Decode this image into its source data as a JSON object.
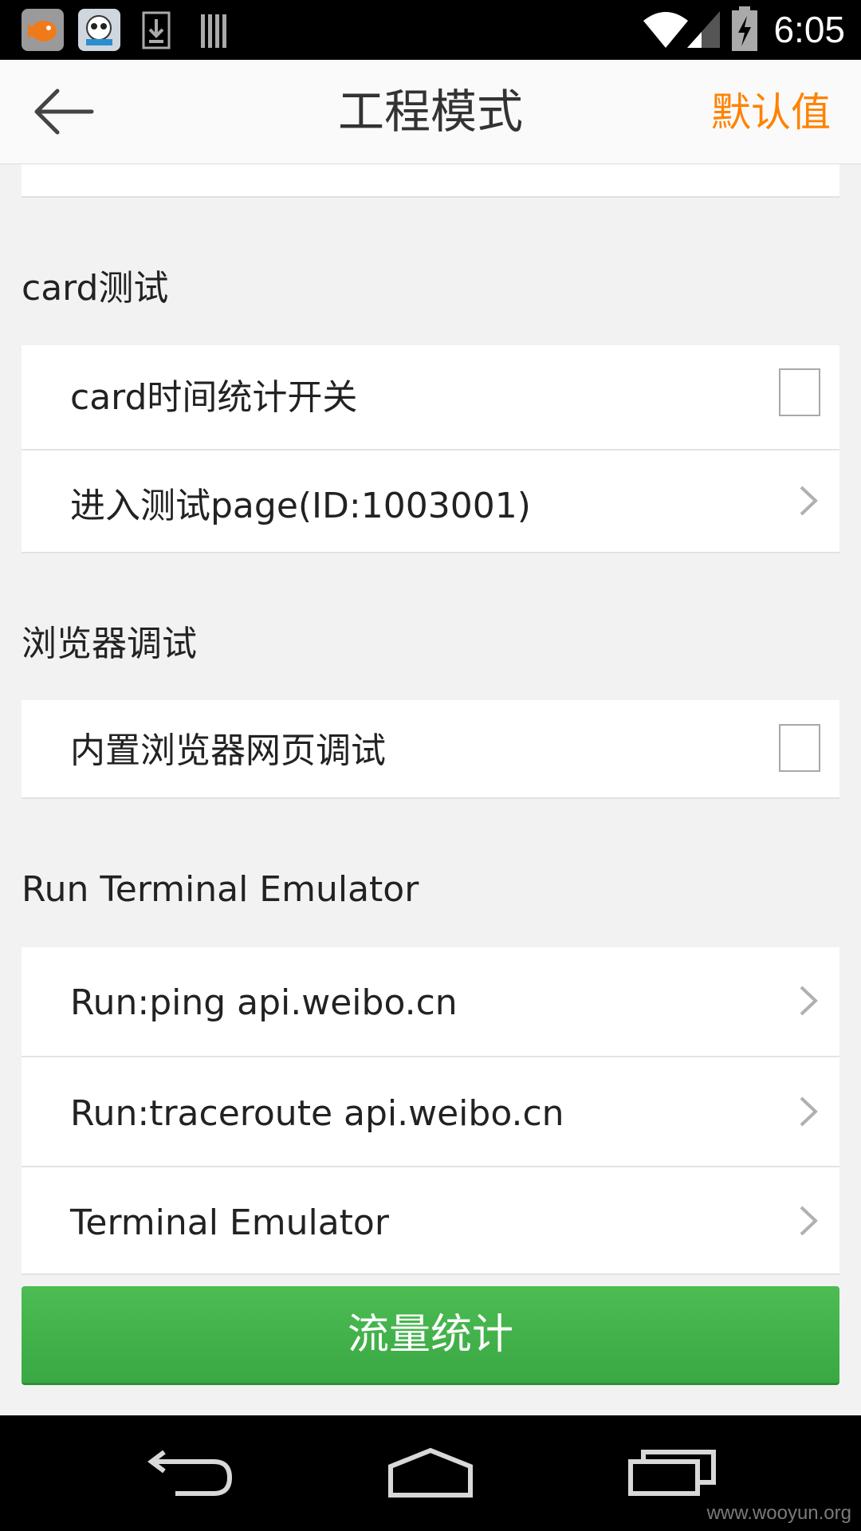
{
  "status_bar": {
    "time": "6:05",
    "icons": [
      "app-fish-icon",
      "app-panda-icon",
      "download-icon",
      "barcode-icon",
      "wifi-icon",
      "signal-icon",
      "battery-charging-icon"
    ]
  },
  "app_bar": {
    "title": "工程模式",
    "back_icon": "arrow-left-icon",
    "default_label": "默认值",
    "accent_color": "#ff8200"
  },
  "sections": {
    "card": {
      "title": "card测试",
      "items": [
        {
          "label": "card时间统计开关",
          "control": "checkbox",
          "checked": false
        },
        {
          "label": "进入测试page(ID:1003001)",
          "control": "chevron"
        }
      ]
    },
    "browser": {
      "title": "浏览器调试",
      "items": [
        {
          "label": "内置浏览器网页调试",
          "control": "checkbox",
          "checked": false
        }
      ]
    },
    "terminal": {
      "title": "Run Terminal Emulator",
      "items": [
        {
          "label": "Run:ping api.weibo.cn",
          "control": "chevron"
        },
        {
          "label": "Run:traceroute api.weibo.cn",
          "control": "chevron"
        },
        {
          "label": "Terminal Emulator",
          "control": "chevron"
        }
      ]
    }
  },
  "traffic_button": {
    "label": "流量统计",
    "color": "#3aa843"
  },
  "nav_bar": {
    "icons": [
      "nav-back-icon",
      "nav-home-icon",
      "nav-recents-icon"
    ]
  },
  "watermark": "www.wooyun.org"
}
